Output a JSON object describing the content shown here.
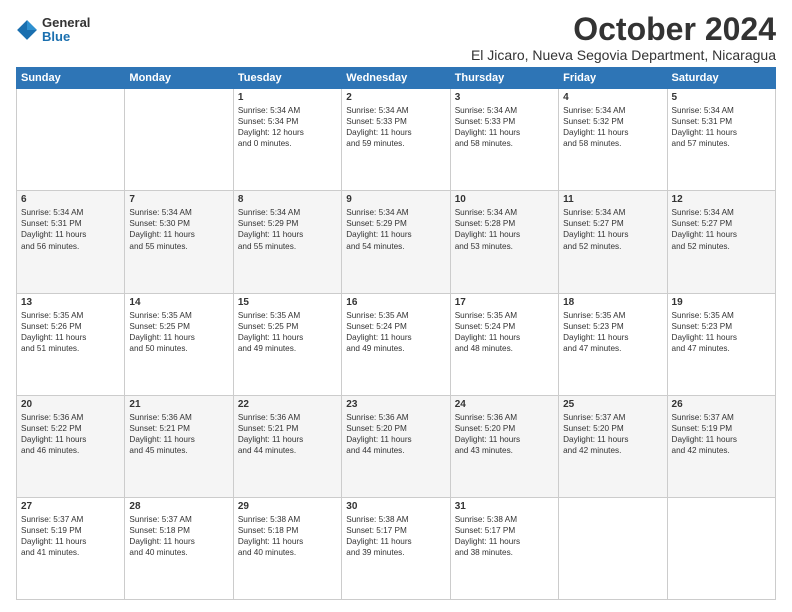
{
  "header": {
    "logo_general": "General",
    "logo_blue": "Blue",
    "month_title": "October 2024",
    "location": "El Jicaro, Nueva Segovia Department, Nicaragua"
  },
  "days_of_week": [
    "Sunday",
    "Monday",
    "Tuesday",
    "Wednesday",
    "Thursday",
    "Friday",
    "Saturday"
  ],
  "weeks": [
    [
      {
        "day": "",
        "content": ""
      },
      {
        "day": "",
        "content": ""
      },
      {
        "day": "1",
        "content": "Sunrise: 5:34 AM\nSunset: 5:34 PM\nDaylight: 12 hours\nand 0 minutes."
      },
      {
        "day": "2",
        "content": "Sunrise: 5:34 AM\nSunset: 5:33 PM\nDaylight: 11 hours\nand 59 minutes."
      },
      {
        "day": "3",
        "content": "Sunrise: 5:34 AM\nSunset: 5:33 PM\nDaylight: 11 hours\nand 58 minutes."
      },
      {
        "day": "4",
        "content": "Sunrise: 5:34 AM\nSunset: 5:32 PM\nDaylight: 11 hours\nand 58 minutes."
      },
      {
        "day": "5",
        "content": "Sunrise: 5:34 AM\nSunset: 5:31 PM\nDaylight: 11 hours\nand 57 minutes."
      }
    ],
    [
      {
        "day": "6",
        "content": "Sunrise: 5:34 AM\nSunset: 5:31 PM\nDaylight: 11 hours\nand 56 minutes."
      },
      {
        "day": "7",
        "content": "Sunrise: 5:34 AM\nSunset: 5:30 PM\nDaylight: 11 hours\nand 55 minutes."
      },
      {
        "day": "8",
        "content": "Sunrise: 5:34 AM\nSunset: 5:29 PM\nDaylight: 11 hours\nand 55 minutes."
      },
      {
        "day": "9",
        "content": "Sunrise: 5:34 AM\nSunset: 5:29 PM\nDaylight: 11 hours\nand 54 minutes."
      },
      {
        "day": "10",
        "content": "Sunrise: 5:34 AM\nSunset: 5:28 PM\nDaylight: 11 hours\nand 53 minutes."
      },
      {
        "day": "11",
        "content": "Sunrise: 5:34 AM\nSunset: 5:27 PM\nDaylight: 11 hours\nand 52 minutes."
      },
      {
        "day": "12",
        "content": "Sunrise: 5:34 AM\nSunset: 5:27 PM\nDaylight: 11 hours\nand 52 minutes."
      }
    ],
    [
      {
        "day": "13",
        "content": "Sunrise: 5:35 AM\nSunset: 5:26 PM\nDaylight: 11 hours\nand 51 minutes."
      },
      {
        "day": "14",
        "content": "Sunrise: 5:35 AM\nSunset: 5:25 PM\nDaylight: 11 hours\nand 50 minutes."
      },
      {
        "day": "15",
        "content": "Sunrise: 5:35 AM\nSunset: 5:25 PM\nDaylight: 11 hours\nand 49 minutes."
      },
      {
        "day": "16",
        "content": "Sunrise: 5:35 AM\nSunset: 5:24 PM\nDaylight: 11 hours\nand 49 minutes."
      },
      {
        "day": "17",
        "content": "Sunrise: 5:35 AM\nSunset: 5:24 PM\nDaylight: 11 hours\nand 48 minutes."
      },
      {
        "day": "18",
        "content": "Sunrise: 5:35 AM\nSunset: 5:23 PM\nDaylight: 11 hours\nand 47 minutes."
      },
      {
        "day": "19",
        "content": "Sunrise: 5:35 AM\nSunset: 5:23 PM\nDaylight: 11 hours\nand 47 minutes."
      }
    ],
    [
      {
        "day": "20",
        "content": "Sunrise: 5:36 AM\nSunset: 5:22 PM\nDaylight: 11 hours\nand 46 minutes."
      },
      {
        "day": "21",
        "content": "Sunrise: 5:36 AM\nSunset: 5:21 PM\nDaylight: 11 hours\nand 45 minutes."
      },
      {
        "day": "22",
        "content": "Sunrise: 5:36 AM\nSunset: 5:21 PM\nDaylight: 11 hours\nand 44 minutes."
      },
      {
        "day": "23",
        "content": "Sunrise: 5:36 AM\nSunset: 5:20 PM\nDaylight: 11 hours\nand 44 minutes."
      },
      {
        "day": "24",
        "content": "Sunrise: 5:36 AM\nSunset: 5:20 PM\nDaylight: 11 hours\nand 43 minutes."
      },
      {
        "day": "25",
        "content": "Sunrise: 5:37 AM\nSunset: 5:20 PM\nDaylight: 11 hours\nand 42 minutes."
      },
      {
        "day": "26",
        "content": "Sunrise: 5:37 AM\nSunset: 5:19 PM\nDaylight: 11 hours\nand 42 minutes."
      }
    ],
    [
      {
        "day": "27",
        "content": "Sunrise: 5:37 AM\nSunset: 5:19 PM\nDaylight: 11 hours\nand 41 minutes."
      },
      {
        "day": "28",
        "content": "Sunrise: 5:37 AM\nSunset: 5:18 PM\nDaylight: 11 hours\nand 40 minutes."
      },
      {
        "day": "29",
        "content": "Sunrise: 5:38 AM\nSunset: 5:18 PM\nDaylight: 11 hours\nand 40 minutes."
      },
      {
        "day": "30",
        "content": "Sunrise: 5:38 AM\nSunset: 5:17 PM\nDaylight: 11 hours\nand 39 minutes."
      },
      {
        "day": "31",
        "content": "Sunrise: 5:38 AM\nSunset: 5:17 PM\nDaylight: 11 hours\nand 38 minutes."
      },
      {
        "day": "",
        "content": ""
      },
      {
        "day": "",
        "content": ""
      }
    ]
  ]
}
